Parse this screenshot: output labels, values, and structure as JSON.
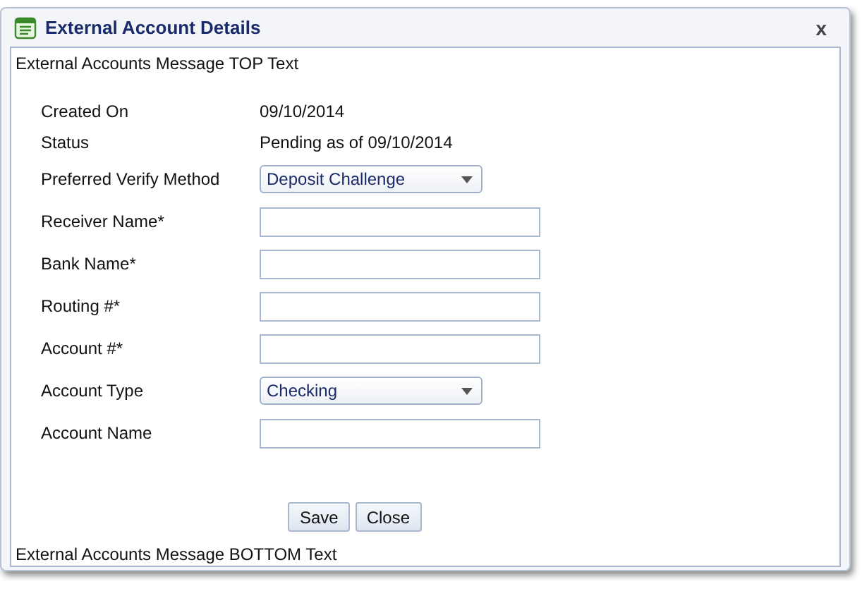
{
  "window": {
    "title": "External Account Details",
    "close": "x"
  },
  "top_message": "External Accounts Message TOP Text",
  "fields": [
    {
      "label": "Created On",
      "kind": "text",
      "value": "09/10/2014"
    },
    {
      "label": "Status",
      "kind": "text",
      "value": "Pending as of 09/10/2014"
    },
    {
      "label": "Preferred Verify Method",
      "kind": "select",
      "value": "Deposit Challenge"
    },
    {
      "label": "Receiver Name*",
      "kind": "input"
    },
    {
      "label": "Bank Name*",
      "kind": "input"
    },
    {
      "label": "Routing #*",
      "kind": "input"
    },
    {
      "label": "Account #*",
      "kind": "input"
    },
    {
      "label": "Account Type",
      "kind": "select",
      "value": "Checking"
    },
    {
      "label": "Account Name",
      "kind": "input"
    }
  ],
  "buttons": [
    "Save",
    "Close"
  ],
  "bottom_message": "External Accounts Message BOTTOM Text"
}
